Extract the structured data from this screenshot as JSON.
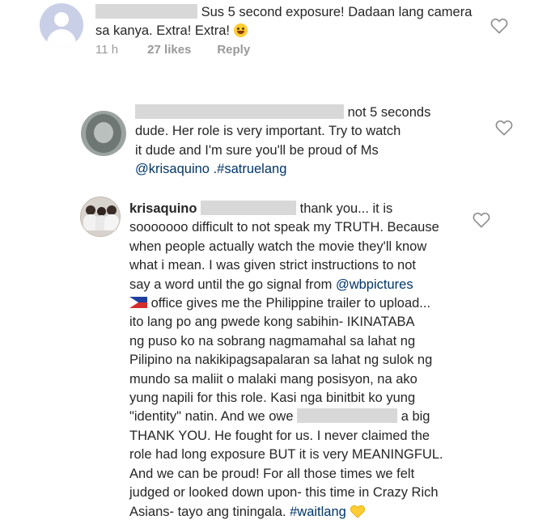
{
  "comments": [
    {
      "lines_after_redaction_first": "Sus 5 second exposure! Dadaan lang camera",
      "line2": "sa kanya. Extra! Extra!",
      "meta": {
        "time": "11 h",
        "likes": "27 likes",
        "reply": "Reply"
      },
      "emoji": "laughing-face"
    },
    {
      "line1": "not 5 seconds",
      "line2": "dude. Her role is very important. Try to watch",
      "line3": "it dude and I'm sure you'll be proud of Ms",
      "line4_link": "@krisaquino",
      "line4_tag": " .#satruelang"
    },
    {
      "username": "krisaquino",
      "line1_after": "thank you... it is",
      "lines": [
        "sooooooo difficult to not speak my TRUTH. Because",
        "when people actually watch the movie they'll know",
        "what i mean. I was given strict instructions to not",
        "say a word until the go signal from "
      ],
      "mention_wb": "@wbpictures",
      "line_flag": " office gives me the Philippine trailer to upload...",
      "lines2": [
        "ito lang po ang pwede kong sabihin- IKINATABA",
        "ng puso ko na sobrang nagmamahal sa lahat ng",
        "Pilipino na nakikipagsapalaran sa lahat ng sulok ng",
        "mundo sa maliit o malaki mang posisyon, na ako",
        "yung napili for this role. Kasi nga binitbit ko yung",
        "\"identity\" natin. And we owe"
      ],
      "big_after": "a big",
      "lines3": [
        "THANK YOU. He fought for us. I never claimed the",
        "role had long exposure BUT it is very MEANINGFUL.",
        "And we can be proud! For all those times we felt",
        "judged or looked down upon- this time in Crazy Rich"
      ],
      "last_line": "Asians- tayo ang tiningala. ",
      "hashtag": "#waitlang"
    }
  ],
  "colors": {
    "text": "#262626",
    "link": "#003569",
    "meta": "#999999",
    "redact": "#d8d8d8"
  },
  "icons": [
    "heart-outline-icon",
    "yellow-heart-emoji",
    "philippine-flag-emoji",
    "laughing-face-emoji"
  ]
}
